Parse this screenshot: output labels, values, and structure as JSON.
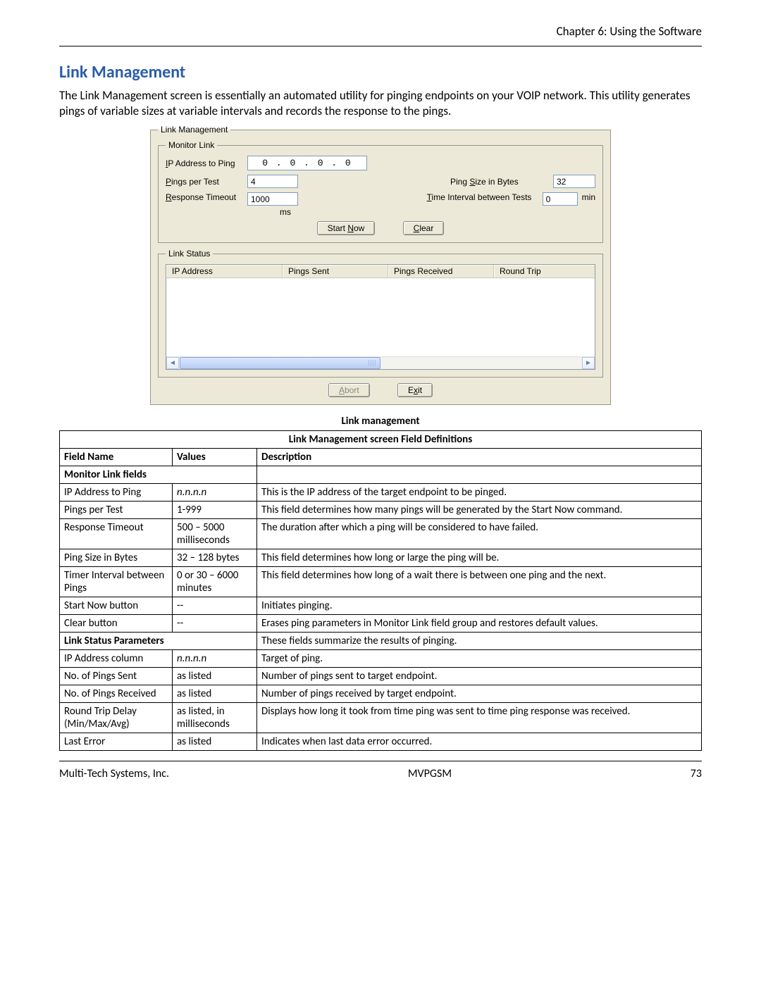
{
  "header": {
    "chapter": "Chapter 6: Using the Software"
  },
  "title": "Link Management",
  "intro": "The Link Management screen is essentially an automated utility for pinging endpoints on your VOIP network. This utility generates pings of variable sizes at variable intervals and records the response to the pings.",
  "dialog": {
    "group_link_management": "Link Management",
    "group_monitor_link": "Monitor Link",
    "group_link_status": "Link Status",
    "labels": {
      "ip_address_to_ping": "IP Address to Ping",
      "pings_per_test": "Pings per Test",
      "response_timeout": "Response Timeout",
      "ping_size_bytes": "Ping Size in Bytes",
      "time_interval": "Time Interval between Tests",
      "ms": "ms",
      "min": "min"
    },
    "values": {
      "ip": "0 . 0 . 0 . 0",
      "pings_per_test": "4",
      "response_timeout": "1000",
      "ping_size": "32",
      "time_interval": "0"
    },
    "buttons": {
      "start_now": "Start Now",
      "clear": "Clear",
      "abort": "Abort",
      "exit": "Exit"
    },
    "columns": {
      "ip_address": "IP Address",
      "pings_sent": "Pings Sent",
      "pings_received": "Pings Received",
      "round_trip": "Round Trip"
    }
  },
  "caption": "Link management",
  "table": {
    "title": "Link Management screen Field Definitions",
    "headers": {
      "field_name": "Field Name",
      "values": "Values",
      "description": "Description"
    },
    "section1": "Monitor Link fields",
    "section2": "Link Status Parameters",
    "section2_desc": "These fields summarize the results of pinging.",
    "rows1": [
      {
        "name": "IP Address to Ping",
        "values": "n.n.n.n",
        "values_italic": true,
        "desc": "This is the IP address of the target endpoint to be pinged."
      },
      {
        "name": "Pings per Test",
        "values": "1-999",
        "desc": "This field determines how many pings will be generated by the Start Now command."
      },
      {
        "name": "Response Timeout",
        "values": "500 – 5000 milliseconds",
        "desc": "The duration after which a ping will be considered to have failed."
      },
      {
        "name": "Ping Size in Bytes",
        "values": "32 – 128 bytes",
        "desc": "This field determines how long or large the ping will be."
      },
      {
        "name": "Timer Interval between Pings",
        "values": "0 or 30 – 6000 minutes",
        "desc": "This field determines how long of a wait there is between one ping and the next."
      },
      {
        "name": "Start Now button",
        "values": "--",
        "desc": "Initiates pinging."
      },
      {
        "name": "Clear button",
        "values": "--",
        "desc": "Erases ping parameters in Monitor Link field group and restores default values."
      }
    ],
    "rows2": [
      {
        "name": "IP Address column",
        "values": "n.n.n.n",
        "values_italic": true,
        "desc": "Target of ping."
      },
      {
        "name": "No. of Pings Sent",
        "values": "as listed",
        "desc": "Number of pings sent to target endpoint."
      },
      {
        "name": "No. of Pings Received",
        "values": "as listed",
        "desc": "Number of pings received by target endpoint."
      },
      {
        "name": "Round Trip Delay (Min/Max/Avg)",
        "values": "as listed, in milliseconds",
        "desc": "Displays how long it took from time ping was sent to time ping response was received."
      },
      {
        "name": "Last Error",
        "values": "as listed",
        "desc": "Indicates when last data error occurred."
      }
    ]
  },
  "footer": {
    "left": "Multi-Tech Systems, Inc.",
    "center": "MVPGSM",
    "right": "73"
  }
}
